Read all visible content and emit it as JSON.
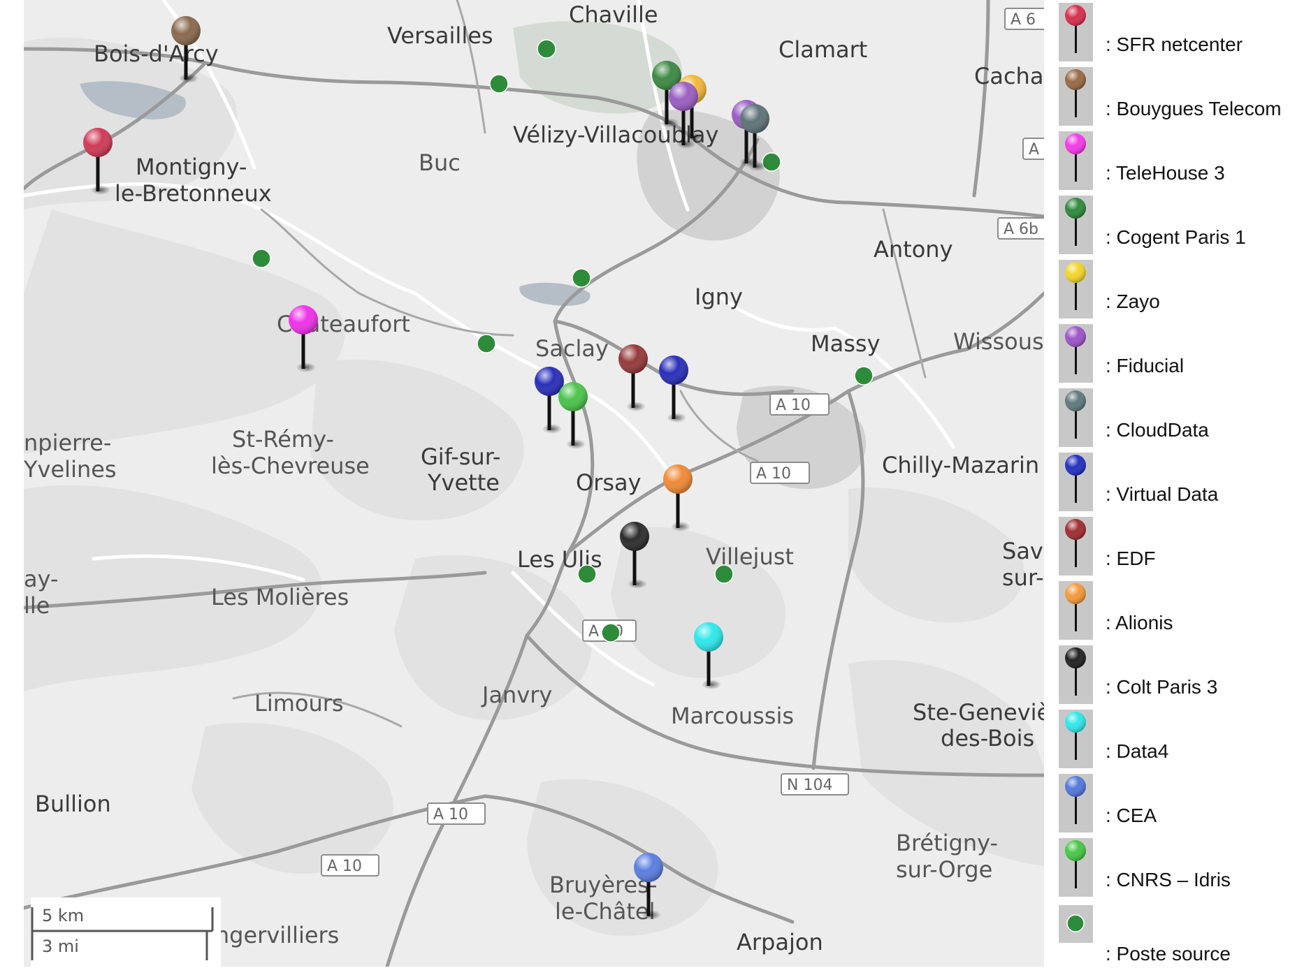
{
  "map": {
    "places": [
      {
        "name": "Bois-d'Arcy"
      },
      {
        "name": "Versailles"
      },
      {
        "name": "Chaville"
      },
      {
        "name": "Clamart"
      },
      {
        "name": "Cacha"
      },
      {
        "name": "Montigny-"
      },
      {
        "name": "le-Bretonneux"
      },
      {
        "name": "Buc"
      },
      {
        "name": "Vélizy-Villacoublay"
      },
      {
        "name": "Antony"
      },
      {
        "name": "Igny"
      },
      {
        "name": "Châteaufort"
      },
      {
        "name": "Saclay"
      },
      {
        "name": "Massy"
      },
      {
        "name": "Wissous"
      },
      {
        "name": "npierre-"
      },
      {
        "name": "Yvelines"
      },
      {
        "name": "St-Rémy-"
      },
      {
        "name": "lès-Chevreuse"
      },
      {
        "name": "Gif-sur-"
      },
      {
        "name": "Yvette"
      },
      {
        "name": "Orsay"
      },
      {
        "name": "Chilly-Mazarin"
      },
      {
        "name": "Les Ulis"
      },
      {
        "name": "Villejust"
      },
      {
        "name": "Savi"
      },
      {
        "name": "sur-"
      },
      {
        "name": "ay-"
      },
      {
        "name": "lle"
      },
      {
        "name": "Les Molières"
      },
      {
        "name": "Limours"
      },
      {
        "name": "Janvry"
      },
      {
        "name": "Marcoussis"
      },
      {
        "name": "Ste-Genevièv"
      },
      {
        "name": "des-Bois"
      },
      {
        "name": "Bullion"
      },
      {
        "name": "Brétigny-"
      },
      {
        "name": "sur-Orge"
      },
      {
        "name": "Bruyères-"
      },
      {
        "name": "le-Châtel"
      },
      {
        "name": "Angervilliers"
      },
      {
        "name": "Arpajon"
      }
    ],
    "road_shields": [
      "A 6",
      "A",
      "A 6b",
      "A 10",
      "A 10",
      "A 10",
      "N 104",
      "A 10",
      "A 10"
    ],
    "markers": [
      {
        "category": "Bouygues Telecom",
        "color": "#8b6a4e"
      },
      {
        "category": "SFR netcenter",
        "color": "#d03b57"
      },
      {
        "category": "Cogent Paris 1",
        "color": "#3f8a45"
      },
      {
        "category": "Zayo",
        "color": "#f3b83a"
      },
      {
        "category": "Fiducial",
        "color": "#9a5fc4"
      },
      {
        "category": "Fiducial",
        "color": "#9a5fc4"
      },
      {
        "category": "CloudData",
        "color": "#5f7477"
      },
      {
        "category": "TeleHouse 3",
        "color": "#f032ea"
      },
      {
        "category": "EDF",
        "color": "#963a3a"
      },
      {
        "category": "Virtual Data",
        "color": "#2a2fbb"
      },
      {
        "category": "Virtual Data",
        "color": "#2a2fbb"
      },
      {
        "category": "CNRS – Idris",
        "color": "#4cc44c"
      },
      {
        "category": "Alionis",
        "color": "#f08a38"
      },
      {
        "category": "Colt Paris 3",
        "color": "#2d2d2d"
      },
      {
        "category": "Data4",
        "color": "#2fe8ea"
      },
      {
        "category": "CEA",
        "color": "#5a7fe0"
      }
    ],
    "poste_source_color": "#2e8b3a",
    "scale_bar": {
      "km": "5 km",
      "mi": "3 mi"
    }
  },
  "legend": {
    "items": [
      {
        "label": ": SFR netcenter",
        "color": "#d8304e",
        "type": "pin"
      },
      {
        "label": ": Bouygues Telecom",
        "color": "#9a6a45",
        "type": "pin"
      },
      {
        "label": ": TeleHouse 3",
        "color": "#f53ae8",
        "type": "pin"
      },
      {
        "label": ": Cogent Paris 1",
        "color": "#2f8a3c",
        "type": "pin"
      },
      {
        "label": ": Zayo",
        "color": "#f2d52a",
        "type": "pin"
      },
      {
        "label": ": Fiducial",
        "color": "#9d55c8",
        "type": "pin"
      },
      {
        "label": ": CloudData",
        "color": "#607a7c",
        "type": "pin"
      },
      {
        "label": ": Virtual Data",
        "color": "#2430c0",
        "type": "pin"
      },
      {
        "label": ": EDF",
        "color": "#a02e34",
        "type": "pin"
      },
      {
        "label": ": Alionis",
        "color": "#f39a3a",
        "type": "pin"
      },
      {
        "label": ": Colt Paris 3",
        "color": "#222222",
        "type": "pin"
      },
      {
        "label": ": Data4",
        "color": "#2fe8ea",
        "type": "pin"
      },
      {
        "label": ": CEA",
        "color": "#5578dc",
        "type": "pin"
      },
      {
        "label": ": CNRS – Idris",
        "color": "#45c845",
        "type": "pin"
      },
      {
        "label": ": Poste source",
        "color": "#2e8b3a",
        "type": "dot"
      }
    ]
  }
}
